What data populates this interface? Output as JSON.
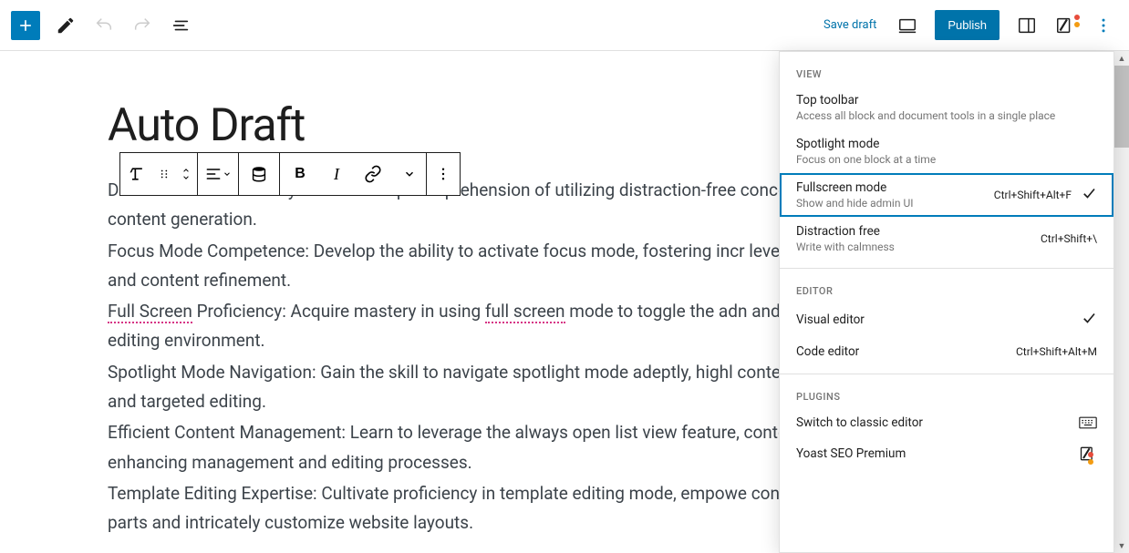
{
  "topbar": {
    "save_draft": "Save draft",
    "publish": "Publish"
  },
  "editor": {
    "title": "Auto Draft",
    "p1a": "Distraction-Free Mastery: Attain a deep comprehension of utilizing distraction-free concentration and streamline content generation.",
    "p2": "Focus Mode Competence: Develop the ability to activate focus mode, fostering incr levels for more effective editing and content refinement.",
    "p3_a": "Full Screen",
    "p3_b": " Proficiency: Acquire mastery in using ",
    "p3_c": "full screen",
    "p3_d": " mode to toggle the adn and off, cultivating an immersive editing environment.",
    "p4": "Spotlight Mode Navigation: Gain the skill to navigate spotlight mode adeptly, highl content elements for meticulous and targeted editing.",
    "p5": "Efficient Content Management: Learn to leverage the always open list view feature, content accessibility and thereby enhancing management and editing processes.",
    "p6": "Template Editing Expertise: Cultivate proficiency in template editing mode, empowe confidently modify template parts and intricately customize website layouts."
  },
  "toolbar": {
    "bold": "B",
    "italic": "I"
  },
  "menu": {
    "view_label": "View",
    "editor_label": "Editor",
    "plugins_label": "Plugins",
    "items": {
      "top_toolbar": {
        "title": "Top toolbar",
        "desc": "Access all block and document tools in a single place"
      },
      "spotlight": {
        "title": "Spotlight mode",
        "desc": "Focus on one block at a time"
      },
      "fullscreen": {
        "title": "Fullscreen mode",
        "desc": "Show and hide admin UI",
        "shortcut": "Ctrl+Shift+Alt+F"
      },
      "distraction": {
        "title": "Distraction free",
        "desc": "Write with calmness",
        "shortcut": "Ctrl+Shift+\\"
      },
      "visual": {
        "title": "Visual editor"
      },
      "code": {
        "title": "Code editor",
        "shortcut": "Ctrl+Shift+Alt+M"
      },
      "classic": {
        "title": "Switch to classic editor"
      },
      "yoast": {
        "title": "Yoast SEO Premium"
      }
    }
  }
}
